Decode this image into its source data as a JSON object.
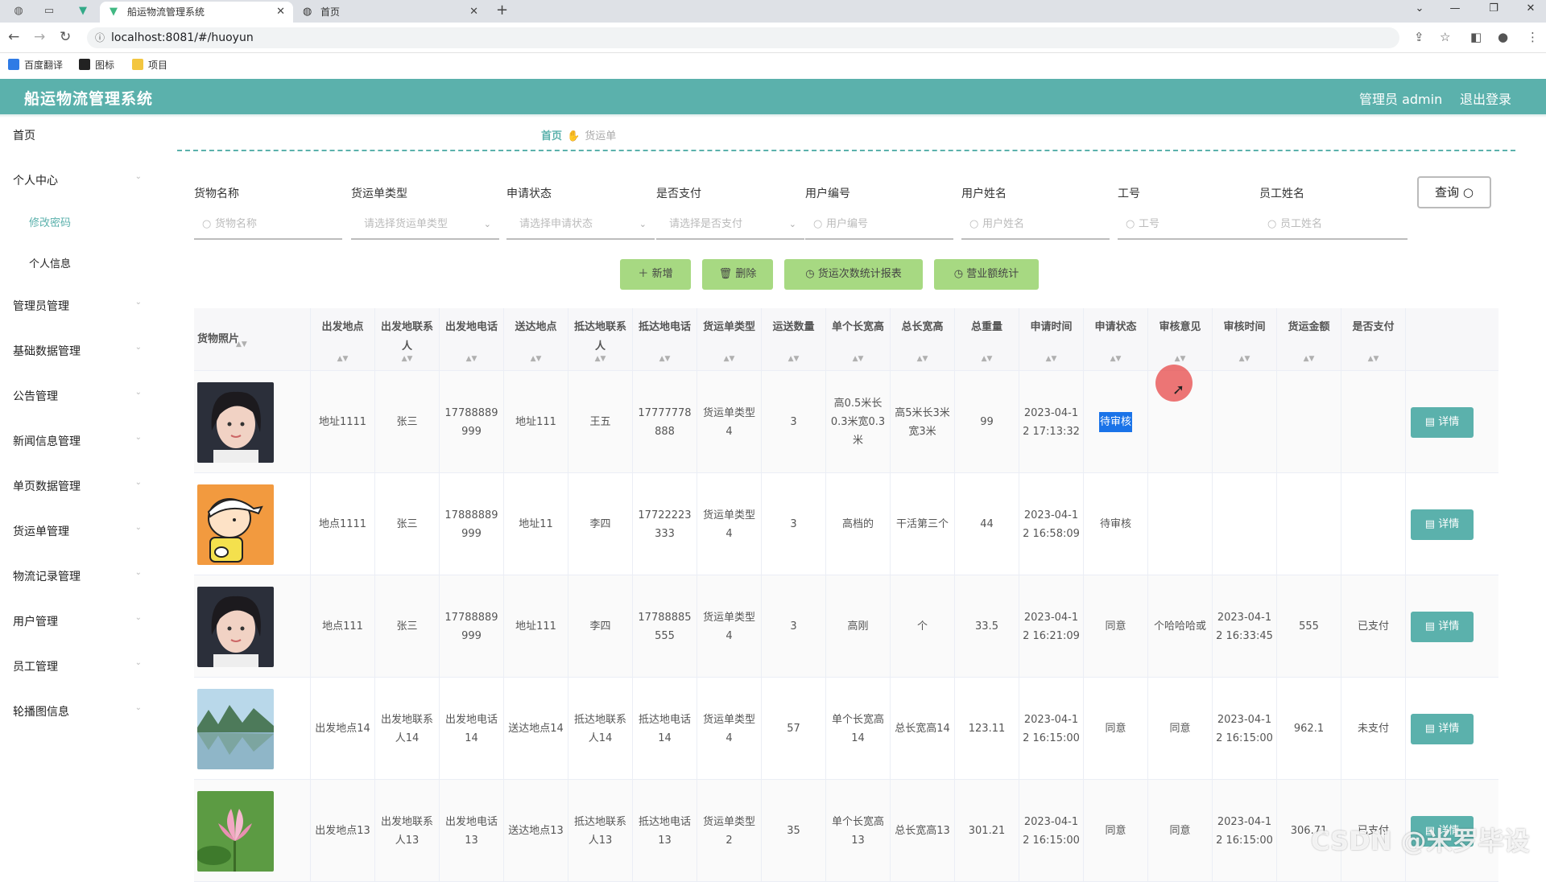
{
  "browser": {
    "tabs": [
      {
        "title": "船运物流管理系统",
        "active": true
      },
      {
        "title": "首页",
        "active": false
      }
    ],
    "url": "localhost:8081/#/huoyun",
    "bookmarks": [
      "百度翻译",
      "图标",
      "项目"
    ]
  },
  "header": {
    "title": "船运物流管理系统",
    "admin": "管理员 admin",
    "logout": "退出登录",
    "color": "#5bb1ac"
  },
  "sidebar": {
    "items": [
      {
        "label": "首页"
      },
      {
        "label": "个人中心"
      },
      {
        "label": "管理员管理"
      },
      {
        "label": "基础数据管理"
      },
      {
        "label": "公告管理"
      },
      {
        "label": "新闻信息管理"
      },
      {
        "label": "单页数据管理"
      },
      {
        "label": "货运单管理"
      },
      {
        "label": "物流记录管理"
      },
      {
        "label": "用户管理"
      },
      {
        "label": "员工管理"
      },
      {
        "label": "轮播图信息"
      }
    ],
    "subitems": [
      {
        "label": "修改密码",
        "active": true
      },
      {
        "label": "个人信息",
        "active": false
      }
    ]
  },
  "breadcrumb": {
    "home": "首页",
    "current": "货运单"
  },
  "filters": [
    {
      "label": "货物名称",
      "placeholder": "货物名称",
      "type": "input"
    },
    {
      "label": "货运单类型",
      "placeholder": "请选择货运单类型",
      "type": "select"
    },
    {
      "label": "申请状态",
      "placeholder": "请选择申请状态",
      "type": "select"
    },
    {
      "label": "是否支付",
      "placeholder": "请选择是否支付",
      "type": "select"
    },
    {
      "label": "用户编号",
      "placeholder": "用户编号",
      "type": "input"
    },
    {
      "label": "用户姓名",
      "placeholder": "用户姓名",
      "type": "input"
    },
    {
      "label": "工号",
      "placeholder": "工号",
      "type": "input"
    },
    {
      "label": "员工姓名",
      "placeholder": "员工姓名",
      "type": "input"
    }
  ],
  "query_button": "查询",
  "actions": {
    "add": "新增",
    "delete": "删除",
    "count_report": "货运次数统计报表",
    "revenue_stats": "营业额统计"
  },
  "table": {
    "columns": [
      "货物照片",
      "出发地点",
      "出发地联系人",
      "出发地电话",
      "送达地点",
      "抵达地联系人",
      "抵达地电话",
      "货运单类型",
      "运送数量",
      "单个长宽高",
      "总长宽高",
      "总重量",
      "申请时间",
      "申请状态",
      "审核意见",
      "审核时间",
      "货运金额",
      "是否支付"
    ],
    "detail_label": "详情",
    "rows": [
      {
        "photo": "girl",
        "from": "地址1111",
        "from_contact": "张三",
        "from_phone": "17788889999",
        "to": "地址111",
        "to_contact": "王五",
        "to_phone": "17777778888",
        "type": "货运单类型4",
        "qty": "3",
        "unit_size": "高0.5米长0.3米宽0.3米",
        "total_size": "高5米长3米宽3米",
        "weight": "99",
        "apply_time": "2023-04-12 17:13:32",
        "status": "待审核",
        "opinion": "",
        "review_time": "",
        "amount": "",
        "paid": ""
      },
      {
        "photo": "cartoon",
        "from": "地点1111",
        "from_contact": "张三",
        "from_phone": "17888889999",
        "to": "地址11",
        "to_contact": "李四",
        "to_phone": "17722223333",
        "type": "货运单类型4",
        "qty": "3",
        "unit_size": "高档的",
        "total_size": "干活第三个",
        "weight": "44",
        "apply_time": "2023-04-12 16:58:09",
        "status": "待审核",
        "opinion": "",
        "review_time": "",
        "amount": "",
        "paid": ""
      },
      {
        "photo": "girl",
        "from": "地点111",
        "from_contact": "张三",
        "from_phone": "17788889999",
        "to": "地址111",
        "to_contact": "李四",
        "to_phone": "17788885555",
        "type": "货运单类型4",
        "qty": "3",
        "unit_size": "高刚",
        "total_size": "个",
        "weight": "33.5",
        "apply_time": "2023-04-12 16:21:09",
        "status": "同意",
        "opinion": "个哈哈哈或",
        "review_time": "2023-04-12 16:33:45",
        "amount": "555",
        "paid": "已支付"
      },
      {
        "photo": "lake",
        "from": "出发地点14",
        "from_contact": "出发地联系人14",
        "from_phone": "出发地电话14",
        "to": "送达地点14",
        "to_contact": "抵达地联系人14",
        "to_phone": "抵达地电话14",
        "type": "货运单类型4",
        "qty": "57",
        "unit_size": "单个长宽高14",
        "total_size": "总长宽高14",
        "weight": "123.11",
        "apply_time": "2023-04-12 16:15:00",
        "status": "同意",
        "opinion": "同意",
        "review_time": "2023-04-12 16:15:00",
        "amount": "962.1",
        "paid": "未支付"
      },
      {
        "photo": "lotus",
        "from": "出发地点13",
        "from_contact": "出发地联系人13",
        "from_phone": "出发地电话13",
        "to": "送达地点13",
        "to_contact": "抵达地联系人13",
        "to_phone": "抵达地电话13",
        "type": "货运单类型2",
        "qty": "35",
        "unit_size": "单个长宽高13",
        "total_size": "总长宽高13",
        "weight": "301.21",
        "apply_time": "2023-04-12 16:15:00",
        "status": "同意",
        "opinion": "同意",
        "review_time": "2023-04-12 16:15:00",
        "amount": "306.71",
        "paid": "已支付"
      }
    ]
  },
  "watermark": "CSDN @米罗毕设"
}
